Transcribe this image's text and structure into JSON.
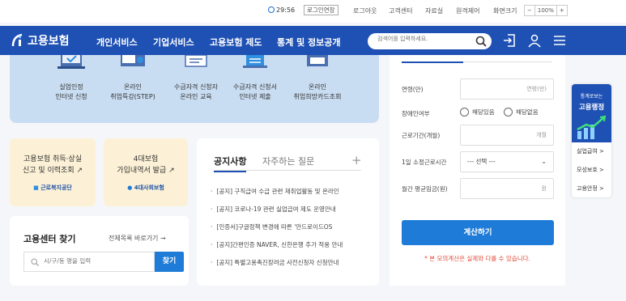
{
  "topbar": {
    "timer": "29:56",
    "extend_label": "로그인연장",
    "logout": "로그아웃",
    "customer_center": "고객센터",
    "archive": "자료실",
    "remote_control": "원격제어",
    "screen_size_label": "화면크기",
    "zoom_minus": "−",
    "zoom_value": "100%",
    "zoom_plus": "+"
  },
  "nav": {
    "logo_text": "고용보험",
    "menu": [
      "개인서비스",
      "기업서비스",
      "고용보험 제도",
      "통계 및 정보공개"
    ],
    "search_placeholder": "검색어를 입력하세요."
  },
  "services": [
    {
      "line1": "실업인정",
      "line2": "인터넷 신청",
      "icon": "monitor-check-icon"
    },
    {
      "line1": "온라인",
      "line2": "취업특강(STEP)",
      "icon": "online-lecture-icon"
    },
    {
      "line1": "수급자격 신청자",
      "line2": "온라인 교육",
      "icon": "monitor-icon"
    },
    {
      "line1": "수급자격 신청서",
      "line2": "인터넷 제출",
      "icon": "document-icon"
    },
    {
      "line1": "온라인",
      "line2": "취업희망카드조회",
      "icon": "card-icon"
    }
  ],
  "quick_cards": [
    {
      "line1": "고용보험 취득·상실",
      "line2": "신고 및 이력조회",
      "org": "근로복지공단"
    },
    {
      "line1": "4대보험",
      "line2": "가입내역서 발급",
      "org": "4대사회보험"
    }
  ],
  "center": {
    "title": "고용센터 찾기",
    "link": "전체목록 바로가기 →",
    "search_placeholder": "시/구/동 명을 입력",
    "search_button": "찾기"
  },
  "notices": {
    "tab_active": "공지사항",
    "tab_inactive": "자주하는 질문",
    "items": [
      "[공지] 구직급여 수급 관련 재취업활동 및 온라인",
      "[공지] 코로나-19 관련 실업급여 제도 운영안내",
      "[인증서]구글정책 변경에 따른 '안드로이드OS",
      "[공지]간편인증 NAVER, 신한은행 추가 적용 안내",
      "[공지] 특별고용촉진장려금 사전신청자 신청안내"
    ]
  },
  "calculator": {
    "age_label": "연령(만)",
    "age_placeholder": "연령(만)",
    "disability_label": "장애인여부",
    "disability_yes": "해당있음",
    "disability_no": "해당없음",
    "service_label": "근로기간(개월)",
    "service_placeholder": "개월",
    "hours_label": "1일 소정근로시간",
    "hours_value": "--- 선택 ---",
    "wage_label": "월간 평균임금(원)",
    "wage_placeholder": "원",
    "button": "계산하기",
    "note": "* 본 모의계산은 실제와 다를 수 있습니다."
  },
  "side": {
    "hero_line1": "통계로보는",
    "hero_line2": "고용행정",
    "links": [
      "실업급여 >",
      "모성보호 >",
      "고용안정 >"
    ]
  }
}
